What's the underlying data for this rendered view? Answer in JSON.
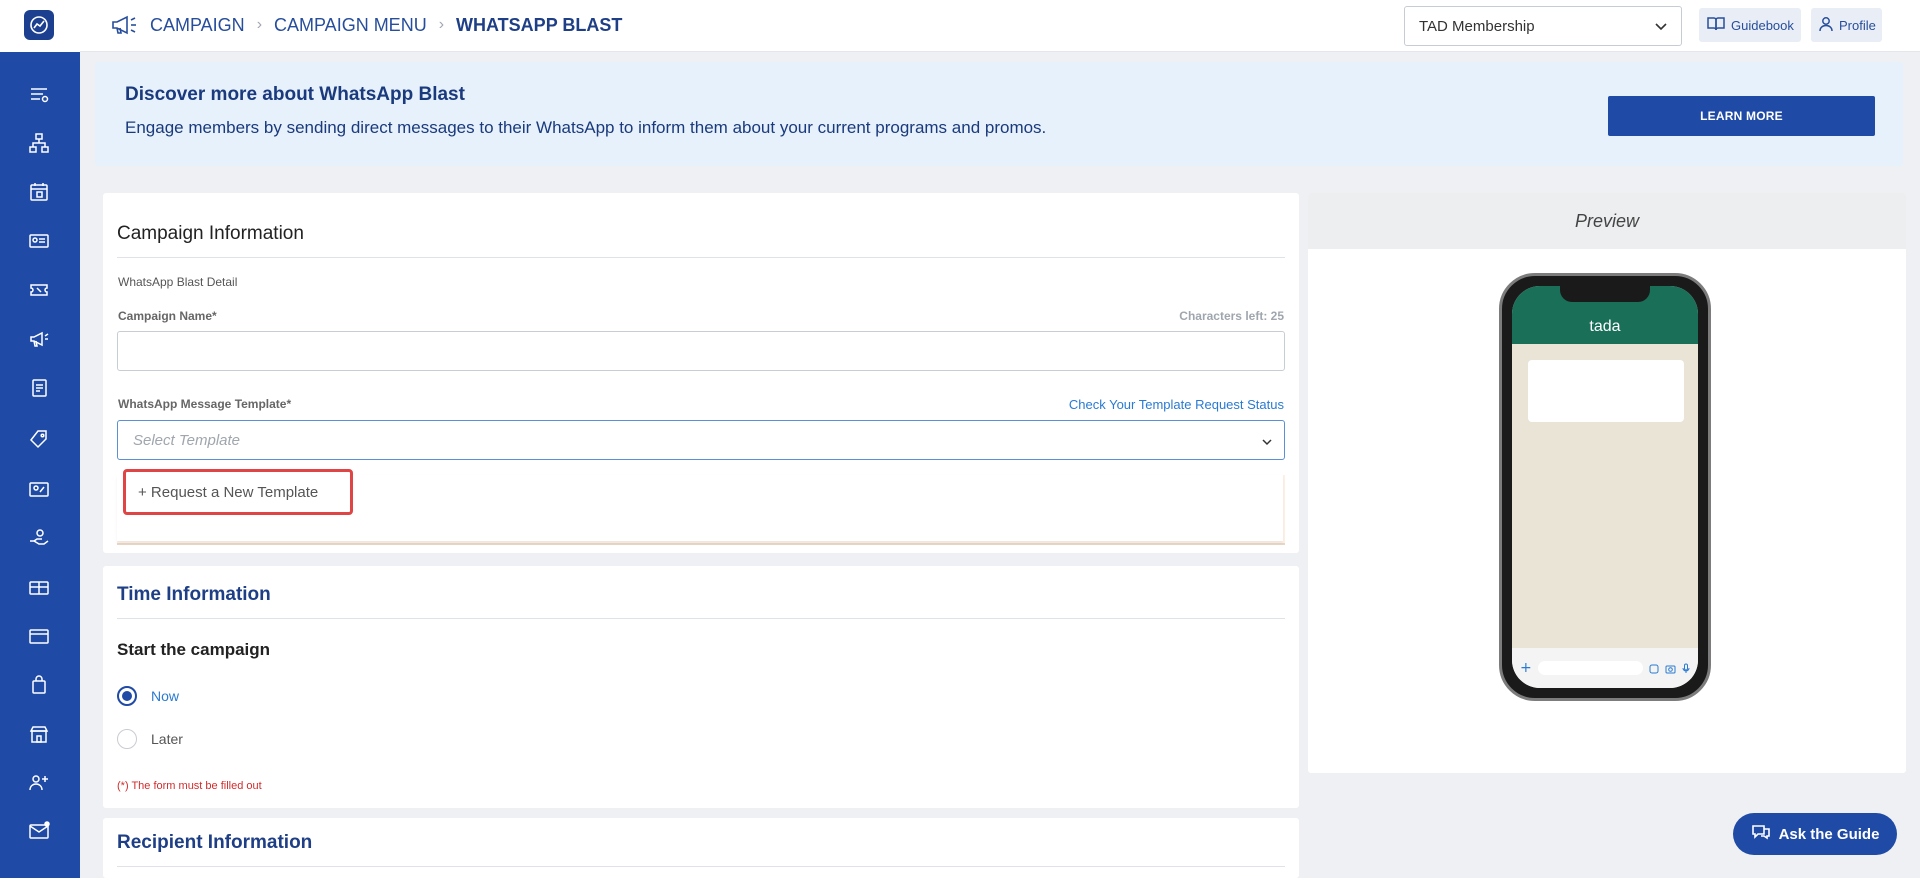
{
  "header": {
    "breadcrumbs": [
      "CAMPAIGN",
      "CAMPAIGN MENU",
      "WHATSAPP BLAST"
    ],
    "membership_select": "TAD Membership",
    "guidebook_label": "Guidebook",
    "profile_label": "Profile"
  },
  "sidebar": {
    "icons": [
      "list-icon",
      "org-chart-icon",
      "calendar-icon",
      "member-card-icon",
      "ticket-icon",
      "megaphone-icon",
      "document-icon",
      "tag-icon",
      "voucher-icon",
      "reward-hand-icon",
      "gift-card-icon",
      "credit-card-icon",
      "shopping-bag-icon",
      "store-icon",
      "add-user-icon",
      "mail-icon"
    ]
  },
  "banner": {
    "title": "Discover more about WhatsApp Blast",
    "description": "Engage members by sending direct messages to their WhatsApp to inform them about your current programs and promos.",
    "learn_more": "LEARN MORE"
  },
  "campaign": {
    "section_title": "Campaign Information",
    "subsection": "WhatsApp Blast Detail",
    "name_label": "Campaign Name*",
    "characters_left": "Characters left: 25",
    "template_label": "WhatsApp Message Template*",
    "check_status_link": "Check Your Template Request Status",
    "template_placeholder": "Select Template",
    "request_new_template": "+ Request a New Template"
  },
  "time": {
    "section_title": "Time Information",
    "start_label": "Start the campaign",
    "option_now": "Now",
    "option_later": "Later",
    "selected": "Now",
    "required_note": "(*) The form must be filled out"
  },
  "recipient": {
    "section_title": "Recipient Information"
  },
  "preview": {
    "title": "Preview",
    "chat_name": "tada"
  },
  "ask_guide": "Ask the Guide",
  "colors": {
    "primary": "#1f4aa5",
    "banner_bg": "#e7f1fb",
    "whatsapp_header": "#1a6f59",
    "error": "#d22c2c",
    "link": "#2a7ad2"
  }
}
